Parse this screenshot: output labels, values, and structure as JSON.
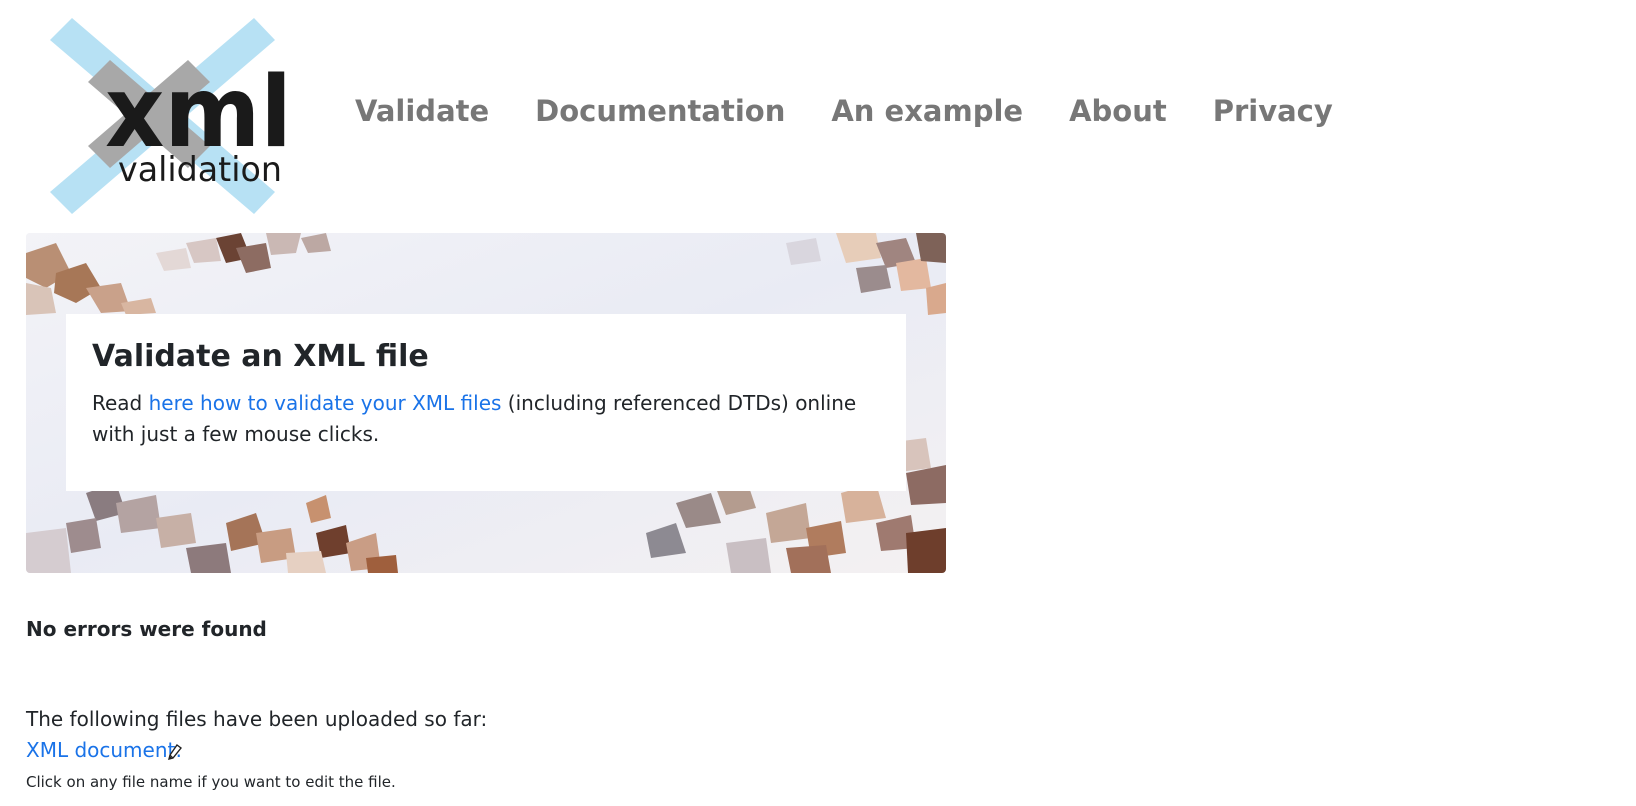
{
  "logo": {
    "word": "xml",
    "subword": "validation"
  },
  "nav": {
    "items": [
      {
        "label": "Validate"
      },
      {
        "label": "Documentation"
      },
      {
        "label": "An example"
      },
      {
        "label": "About"
      },
      {
        "label": "Privacy"
      }
    ]
  },
  "hero": {
    "title": "Validate an XML file",
    "text_before": "Read ",
    "link_text": "here how to validate your XML files",
    "text_after": " (including referenced DTDs) online with just a few mouse clicks."
  },
  "results": {
    "status": "No errors were found",
    "uploaded_intro": "The following files have been uploaded so far:",
    "file_label": "XML document:",
    "edit_icon": "pencil-icon",
    "hint": "Click on any file name if you want to edit the file."
  },
  "colors": {
    "link": "#1a73e8",
    "nav": "#777777",
    "logo_x": "#b7e1f4",
    "logo_text": "#1a1a1a"
  }
}
